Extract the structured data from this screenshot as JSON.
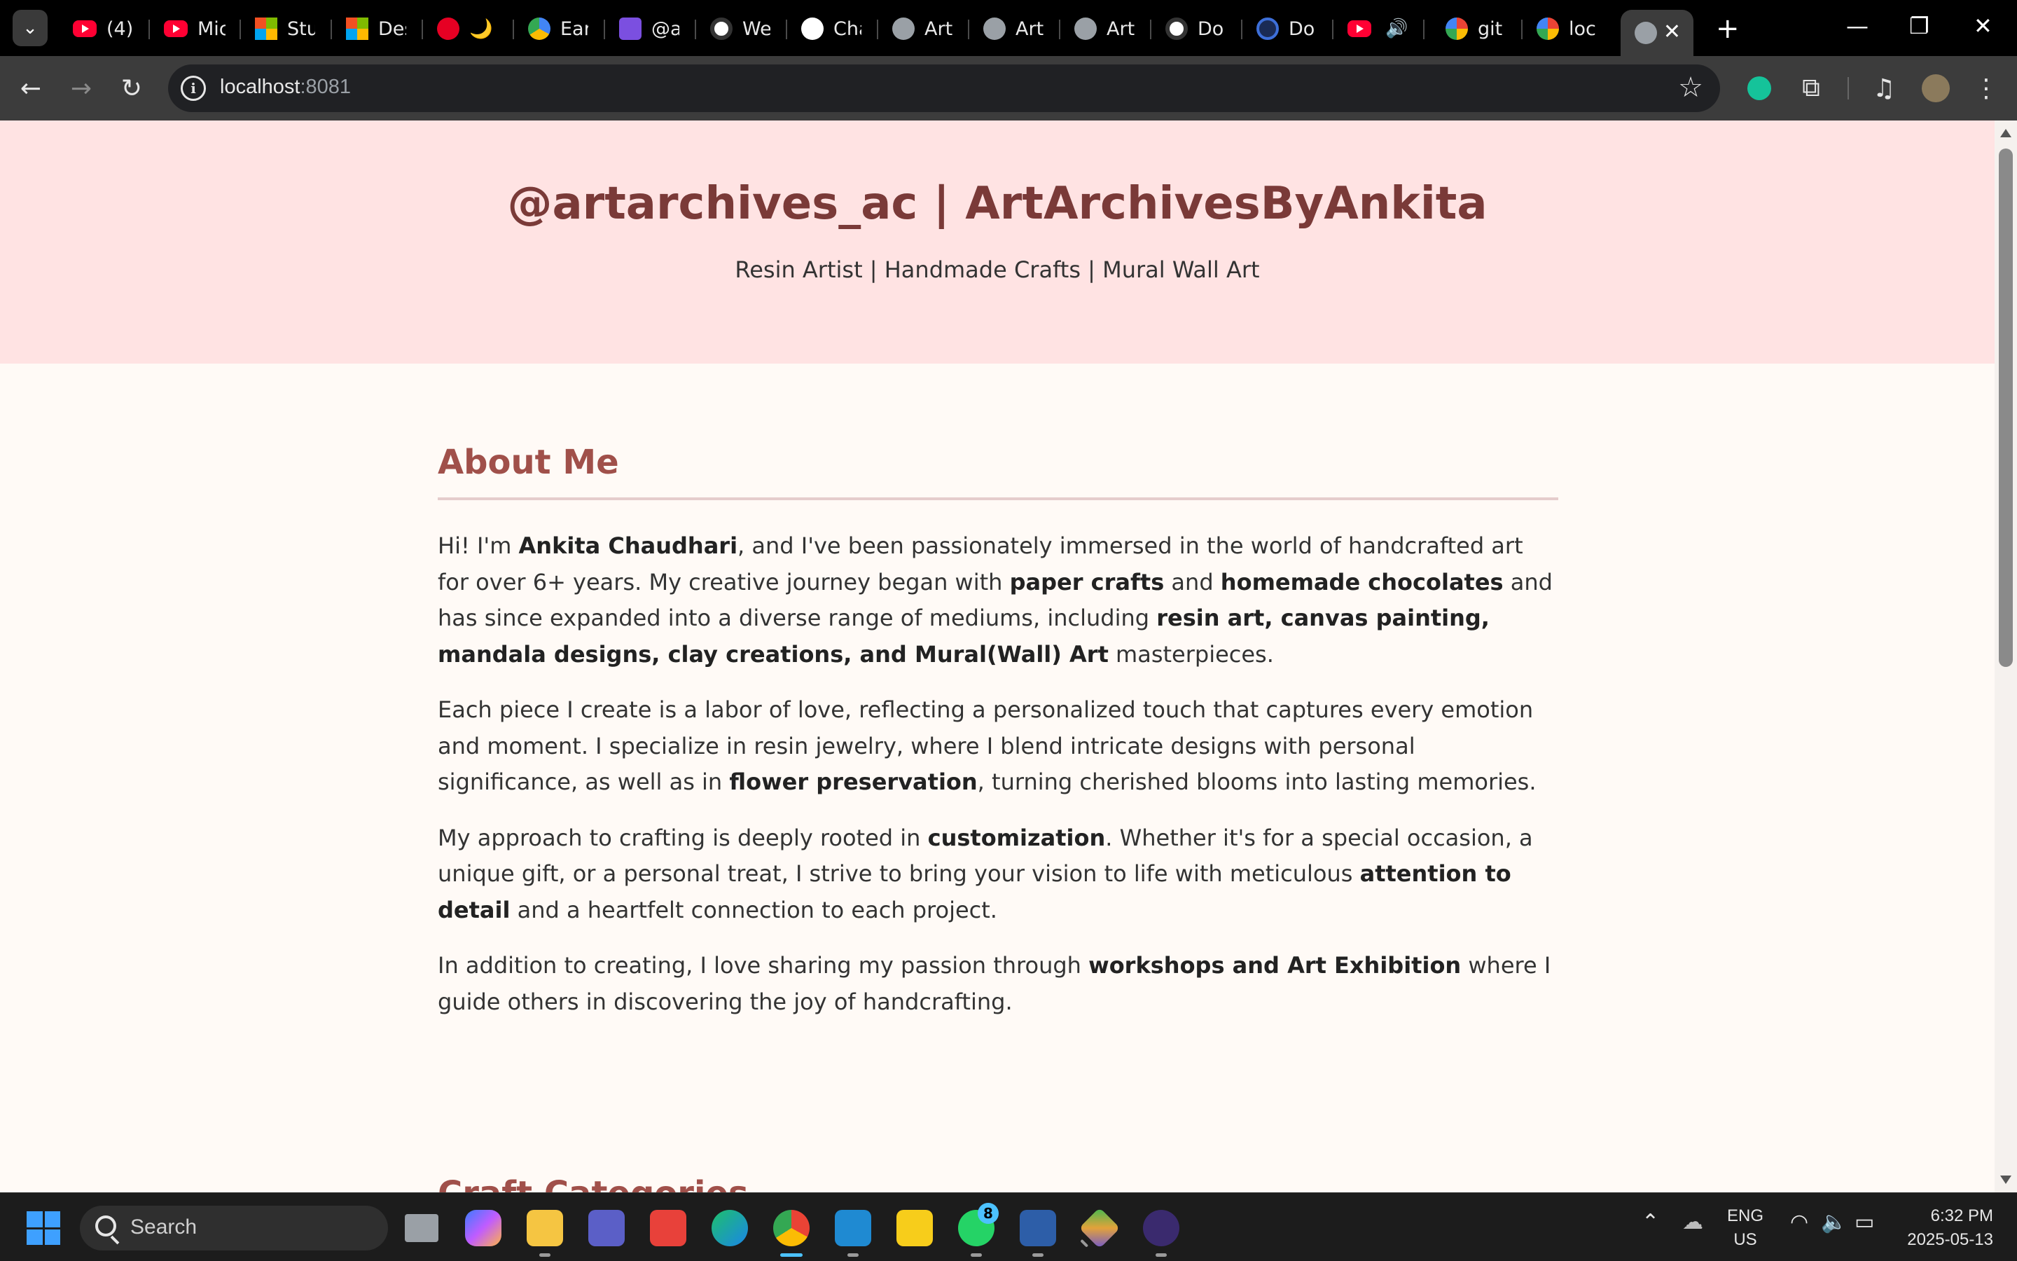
{
  "browser": {
    "tabs": [
      {
        "icon": "youtube-icon",
        "title": "(4)"
      },
      {
        "icon": "youtube-icon",
        "title": "Mic"
      },
      {
        "icon": "microsoft-icon",
        "title": "Stu"
      },
      {
        "icon": "microsoft-icon",
        "title": "Des"
      },
      {
        "icon": "pinterest-icon",
        "title": "🌙 ."
      },
      {
        "icon": "cloud-icon",
        "title": "Ear"
      },
      {
        "icon": "calendar-icon",
        "title": "@a"
      },
      {
        "icon": "openai-icon",
        "title": "We"
      },
      {
        "icon": "github-icon",
        "title": "Cha"
      },
      {
        "icon": "globe-icon",
        "title": "Art"
      },
      {
        "icon": "globe-icon",
        "title": "Art"
      },
      {
        "icon": "globe-icon",
        "title": "Art"
      },
      {
        "icon": "openai-icon",
        "title": "Do"
      },
      {
        "icon": "docs-icon",
        "title": "Do"
      },
      {
        "icon": "youtube-icon",
        "title": ""
      },
      {
        "icon": "google-icon",
        "title": "git"
      },
      {
        "icon": "google-icon",
        "title": "loc"
      }
    ],
    "url_host": "localhost",
    "url_port": ":8081"
  },
  "hero": {
    "title": "@artarchives_ac | ArtArchivesByAnkita",
    "subtitle": "Resin Artist | Handmade Crafts | Mural Wall Art"
  },
  "about": {
    "heading": "About Me",
    "p1": {
      "t1": "Hi! I'm ",
      "b1": "Ankita Chaudhari",
      "t2": ", and I've been passionately immersed in the world of handcrafted art for over 6+ years. My creative journey began with ",
      "b2": "paper crafts",
      "t3": " and ",
      "b3": "homemade chocolates",
      "t4": " and has since expanded into a diverse range of mediums, including ",
      "b4": "resin art, canvas painting, mandala designs, clay creations, and Mural(Wall) Art",
      "t5": " masterpieces."
    },
    "p2": {
      "t1": "Each piece I create is a labor of love, reflecting a personalized touch that captures every emotion and moment. I specialize in resin jewelry, where I blend intricate designs with personal significance, as well as in ",
      "b1": "flower preservation",
      "t2": ", turning cherished blooms into lasting memories."
    },
    "p3": {
      "t1": "My approach to crafting is deeply rooted in ",
      "b1": "customization",
      "t2": ". Whether it's for a special occasion, a unique gift, or a personal treat, I strive to bring your vision to life with meticulous ",
      "b2": "attention to detail",
      "t3": " and a heartfelt connection to each project."
    },
    "p4": {
      "t1": "In addition to creating, I love sharing my passion through ",
      "b1": "workshops and Art Exhibition",
      "t2": " where I guide others in discovering the joy of handcrafting."
    }
  },
  "next_section_heading": "Craft Categories",
  "taskbar": {
    "search_label": "Search",
    "whatsapp_badge": "8",
    "lang_line1": "ENG",
    "lang_line2": "US",
    "time": "6:32 PM",
    "date": "2025-05-13"
  },
  "colors": {
    "hero_bg": "#ffe3e3",
    "title": "#7a3a38",
    "heading": "#a0504a",
    "page_bg": "#fffaf6"
  }
}
